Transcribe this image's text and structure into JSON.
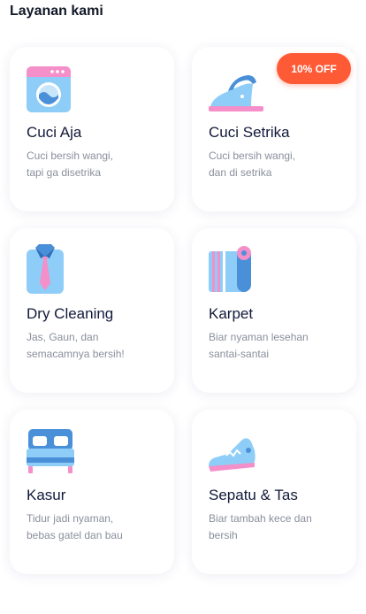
{
  "section_title": "Layanan kami",
  "colors": {
    "icon_blue": "#8ecdf7",
    "icon_deep_blue": "#4a90d9",
    "icon_pink": "#f48fc9",
    "badge": "#ff5a36"
  },
  "services": [
    {
      "title": " Cuci Aja",
      "description": "Cuci bersih wangi,\ntapi ga disetrika",
      "icon": "washing-machine-icon"
    },
    {
      "title": "Cuci Setrika",
      "description": "Cuci bersih wangi,\ndan di setrika",
      "icon": "iron-icon",
      "badge": "10% OFF"
    },
    {
      "title": "Dry Cleaning",
      "description": "Jas, Gaun, dan\nsemacamnya bersih!",
      "icon": "shirt-tie-icon"
    },
    {
      "title": "Karpet",
      "description": "Biar nyaman lesehan\nsantai-santai",
      "icon": "carpet-icon"
    },
    {
      "title": "Kasur",
      "description": "Tidur jadi nyaman,\nbebas gatel dan bau",
      "icon": "bed-icon"
    },
    {
      "title": "Sepatu & Tas",
      "description": "Biar tambah kece dan\nbersih",
      "icon": "sneaker-icon"
    }
  ]
}
